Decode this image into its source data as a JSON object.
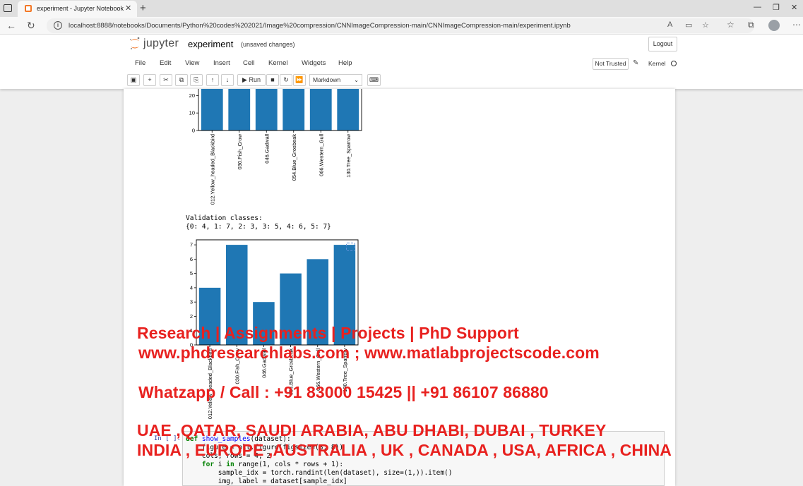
{
  "browser": {
    "tab_title": "experiment - Jupyter Notebook",
    "tab_close": "✕",
    "new_tab": "+",
    "url": "localhost:8888/notebooks/Documents/Python%20codes%202021/Image%20compression/CNNImageCompression-main/CNNImageCompression-main/experiment.ipynb",
    "win_min": "—",
    "win_max": "❐",
    "win_close": "✕"
  },
  "jupyter": {
    "logo_text": "jupyter",
    "notebook_name": "experiment",
    "save_status": "(unsaved changes)",
    "logout_label": "Logout",
    "menu": [
      "File",
      "Edit",
      "View",
      "Insert",
      "Cell",
      "Kernel",
      "Widgets",
      "Help"
    ],
    "trust_label": "Not Trusted",
    "kernel_label": "Kernel",
    "run_label": "Run",
    "cell_type": "Markdown"
  },
  "output": {
    "validation_header": "Validation classes:",
    "validation_dict": "{0: 4, 1: 7, 2: 3, 3: 5, 4: 6, 5: 7}"
  },
  "chart_data": [
    {
      "type": "bar",
      "categories": [
        "012.Yellow_headed_Blackbird",
        "030.Fish_Crow",
        "046.Gadwall",
        "054.Blue_Grosbeak",
        "066.Western_Gull",
        "130.Tree_Sparrow"
      ],
      "category_labels": [
        "012.Yellow_headed_Blackbird",
        "030.Fish_Crow",
        "046.Gadwall",
        "054.Blue_Grosbeak",
        "066.Western_Gull",
        "130.Tree_Sparrow"
      ],
      "values": [
        25,
        25,
        25,
        25,
        25,
        25
      ],
      "yticks": [
        "0",
        "10",
        "20"
      ],
      "ylim": [
        0,
        27
      ],
      "color": "#1f77b4",
      "note": "chart partially scrolled out of view at top"
    },
    {
      "type": "bar",
      "categories": [
        "012.Yellow_headed_Blackbird",
        "030.Fish_Crow",
        "046.Gadwall",
        "054.Blue_Grosbeak",
        "066.Western_Gull",
        "130.Tree_Sparrow"
      ],
      "category_labels": [
        "012.Yellow_headed_Blackbird",
        "030.Fish_Crow",
        "046.Gadwall",
        "054.Blue_Grosbeak",
        "066.Western_Gull",
        "130.Tree_Sparrow"
      ],
      "values": [
        4,
        7,
        3,
        5,
        6,
        7
      ],
      "yticks": [
        "0",
        "1",
        "2",
        "3",
        "4",
        "5",
        "6",
        "7"
      ],
      "ylim": [
        0,
        7.35
      ],
      "color": "#1f77b4"
    }
  ],
  "code_cell": {
    "prompt": "In [ ]:",
    "lines": [
      "def show_samples(dataset):",
      "    figure = plt.figure(figsize=(8, 8))",
      "    cols, rows = 4, 2",
      "    for i in range(1, cols * rows + 1):",
      "        sample_idx = torch.randint(len(dataset), size=(1,)).item()",
      "        img, label = dataset[sample_idx]"
    ]
  },
  "watermark": {
    "line1": "Research | Assignments | Projects | PhD Support",
    "line2": "www.phdresearchlabs.com ; www.matlabprojectscode.com",
    "line3": "Whatzapp / Call : +91 83000 15425 || +91 86107 86880",
    "line4": "UAE ,QATAR, SAUDI ARABIA, ABU DHABI, DUBAI , TURKEY",
    "line5": "INDIA , EUROPE ,AUSTRALIA , UK , CANADA , USA, AFRICA , CHINA"
  }
}
